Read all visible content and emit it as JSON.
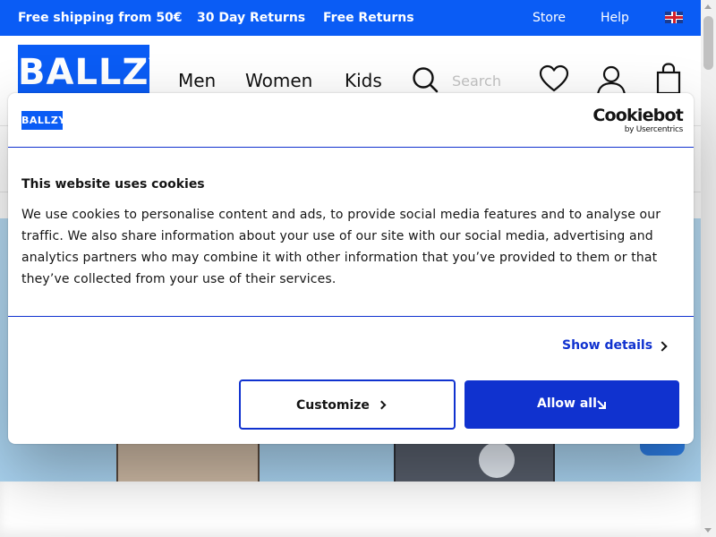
{
  "promo": {
    "shipping": "Free shipping from 50€",
    "returns_days": "30 Day Returns",
    "free_returns": "Free Returns",
    "store": "Store",
    "help": "Help",
    "language_icon": "uk-flag-icon"
  },
  "header": {
    "logo": "BALLZY",
    "nav": {
      "men": "Men",
      "women": "Women",
      "kids": "Kids"
    },
    "search": {
      "placeholder": "Search",
      "icon": "search-icon"
    },
    "icons": [
      "heart-icon",
      "user-icon",
      "bag-icon"
    ]
  },
  "cookie_dialog": {
    "logo": "BALLZY",
    "brand": "Cookiebot",
    "brand_by": "by Usercentrics",
    "title": "This website uses cookies",
    "body": "We use cookies to personalise content and ads, to provide social media features and to analyse our traffic. We also share information about your use of our site with our social media, advertising and analytics partners who may combine it with other information that you’ve provided to them or that they’ve collected from your use of their services.",
    "show_details": "Show details",
    "customize": "Customize",
    "allow_all": "Allow all"
  },
  "colors": {
    "brand_blue": "#0a5cf5",
    "cookiebot_blue": "#1032cf",
    "hero_sky": "#b7dbf3"
  }
}
